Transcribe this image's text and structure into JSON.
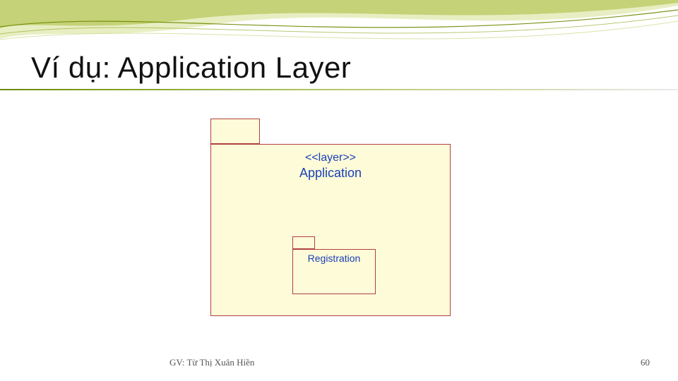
{
  "slide": {
    "title": "Ví dụ: Application Layer",
    "author_footer": "GV: Từ Thị Xuân Hiền",
    "page_number": "60"
  },
  "diagram": {
    "outer_package": {
      "stereotype": "<<layer>>",
      "name": "Application"
    },
    "inner_package": {
      "name": "Registration"
    }
  },
  "colors": {
    "package_fill": "#fdfbd8",
    "package_border": "#b04040",
    "label_text": "#1a3fb8",
    "swoosh_green": "#6a8a00"
  }
}
